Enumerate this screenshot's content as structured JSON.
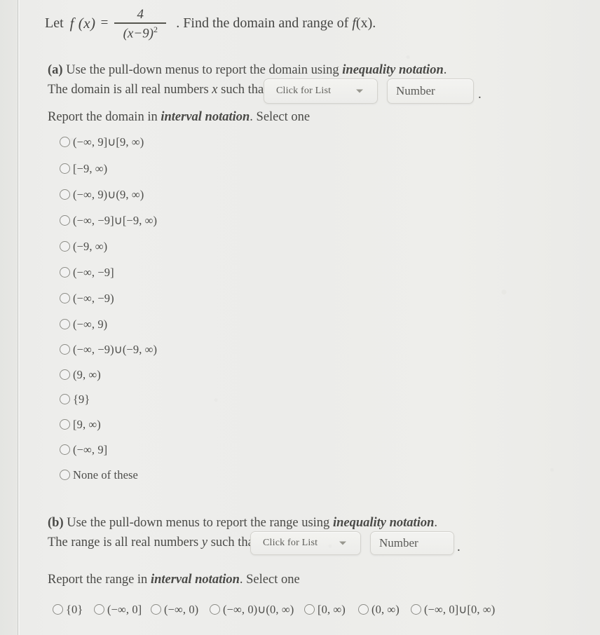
{
  "problem": {
    "lead": "Let",
    "function_name": "f (x)",
    "equals": "=",
    "numerator": "4",
    "denominator": "(x−9)",
    "denominator_exponent": "2",
    "question": ". Find the domain and range of",
    "question_fx": "f",
    "question_fx_arg": "(x)",
    "question_end": "."
  },
  "part_a": {
    "label": "(a)",
    "instruction_plain": "Use the pull-down menus to report the domain using",
    "instruction_emph": "inequality notation",
    "instruction_period": ".",
    "sentence_prefix": "The domain is all real numbers",
    "variable": "x",
    "sentence_suffix": "such that",
    "select_label": "Click for List",
    "number_placeholder": "Number",
    "trailing_period": ".",
    "interval_prompt_prefix": "Report the domain in",
    "interval_prompt_emph": "interval notation",
    "interval_prompt_suffix": ". Select one",
    "options": [
      "(−∞, 9]∪[9, ∞)",
      "[−9, ∞)",
      "(−∞, 9)∪(9, ∞)",
      "(−∞, −9]∪[−9, ∞)",
      "(−9, ∞)",
      "(−∞, −9]",
      "(−∞, −9)",
      "(−∞, 9)",
      "(−∞, −9)∪(−9, ∞)",
      "(9, ∞)",
      "{9}",
      "[9, ∞)",
      "(−∞, 9]",
      "None of these"
    ]
  },
  "part_b": {
    "label": "(b)",
    "instruction_plain": "Use the pull-down menus to report the range using",
    "instruction_emph": "inequality notation",
    "instruction_period": ".",
    "sentence_prefix": "The range is all real numbers",
    "variable": "y",
    "sentence_suffix": "such that",
    "select_label": "Click for List",
    "number_placeholder": "Number",
    "trailing_period": ".",
    "interval_prompt_prefix": "Report the range in",
    "interval_prompt_emph": "interval notation",
    "interval_prompt_suffix": ". Select one",
    "options": [
      "{0}",
      "(−∞, 0]",
      "(−∞, 0)",
      "(−∞, 0)∪(0, ∞)",
      "[0, ∞)",
      "(0, ∞)",
      "(−∞, 0]∪[0, ∞)"
    ]
  },
  "colors": {
    "page_background": "#e9e9e6",
    "text": "#4a4a47",
    "widget_border": "#d3d2cd",
    "radio_border": "#8c8c86",
    "margin_rule": "#787d78"
  }
}
